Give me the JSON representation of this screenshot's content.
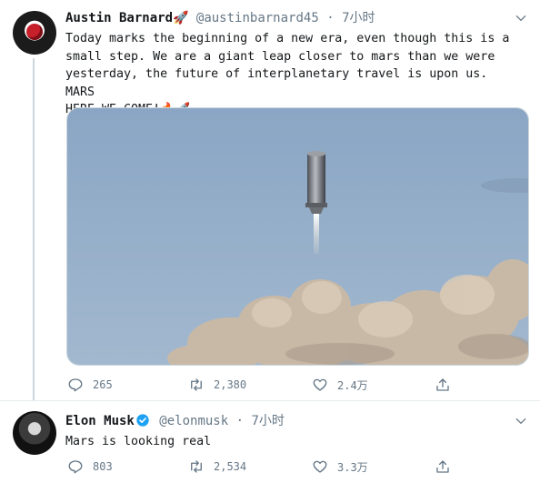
{
  "tweets": [
    {
      "author_name": "Austin Barnard",
      "author_emoji": "🚀",
      "handle": "@austinbarnard45",
      "separator": "·",
      "time": "7小时",
      "text": "Today marks the beginning of a new era, even though this is a\nsmall step. We are a giant leap closer to mars than we were\nyesterday, the future of interplanetary travel is upon us. MARS\nHERE WE COME!🔥🚀",
      "reply_count": "265",
      "retweet_count": "2,380",
      "like_count": "2.4万"
    },
    {
      "author_name": "Elon Musk",
      "handle": "@elonmusk",
      "separator": "·",
      "time": "7小时",
      "text": "Mars is looking real",
      "reply_count": "803",
      "retweet_count": "2,534",
      "like_count": "3.3万"
    }
  ],
  "colors": {
    "text_primary": "#14171a",
    "text_secondary": "#657786",
    "verified_blue": "#1da1f2",
    "divider": "#e6ecf0",
    "thread_line": "#ccd6dd"
  },
  "icons": [
    "reply-icon",
    "retweet-icon",
    "like-icon",
    "share-icon",
    "caret-down-icon",
    "verified-badge-icon"
  ]
}
